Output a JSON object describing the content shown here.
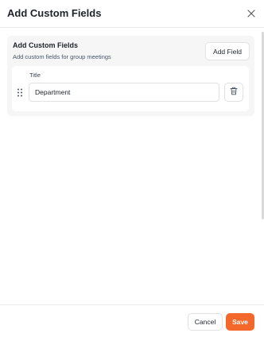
{
  "dialog": {
    "title": "Add Custom Fields",
    "close_icon": "close-icon"
  },
  "section": {
    "title": "Add Custom Fields",
    "subtitle": "Add custom fields for group meetings",
    "add_button_label": "Add Field"
  },
  "fields": [
    {
      "label": "Title",
      "value": "Department",
      "drag_icon": "drag-handle-icon",
      "delete_icon": "trash-icon"
    }
  ],
  "footer": {
    "cancel_label": "Cancel",
    "save_label": "Save"
  },
  "colors": {
    "accent": "#f4682b",
    "panel_bg": "#f6f6f7",
    "border": "#e2e2e2"
  }
}
